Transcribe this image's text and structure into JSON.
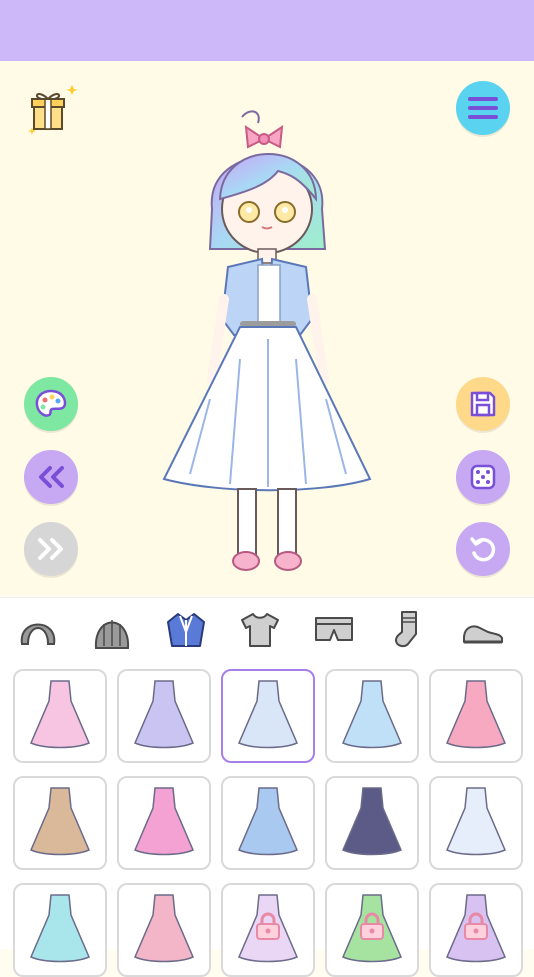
{
  "colors": {
    "topbar": "#cdb9fa",
    "stage_bg": "#fffbe6",
    "accent_purple": "#c7a8f2",
    "menu_blue": "#5ad3f0",
    "palette_green": "#7ee7a1",
    "save_yellow": "#ffd98a",
    "disabled_gray": "#d6d6d6",
    "selected_border": "#a77fe6"
  },
  "top_left": {
    "icon": "gift-box-icon"
  },
  "top_right": {
    "icon": "hamburger-menu-icon"
  },
  "left_controls": [
    {
      "name": "color-palette-button",
      "icon": "palette-icon"
    },
    {
      "name": "previous-button",
      "icon": "double-chevron-left-icon"
    },
    {
      "name": "next-button",
      "icon": "double-chevron-right-icon",
      "disabled": true
    }
  ],
  "right_controls": [
    {
      "name": "save-button",
      "icon": "floppy-disk-icon"
    },
    {
      "name": "randomize-button",
      "icon": "dice-icon"
    },
    {
      "name": "reset-button",
      "icon": "undo-icon"
    }
  ],
  "categories": [
    {
      "name": "hair",
      "icon": "hair-icon"
    },
    {
      "name": "back-hair",
      "icon": "long-hair-icon"
    },
    {
      "name": "jacket",
      "icon": "jacket-icon",
      "selected": true
    },
    {
      "name": "top",
      "icon": "tshirt-icon"
    },
    {
      "name": "bottom",
      "icon": "shorts-icon"
    },
    {
      "name": "socks",
      "icon": "sock-icon"
    },
    {
      "name": "shoes",
      "icon": "shoe-icon"
    }
  ],
  "items": [
    {
      "name": "pink-tiered-dress",
      "color": "#f7c4e2",
      "locked": false
    },
    {
      "name": "lavender-dress",
      "color": "#c9c4f2",
      "locked": false
    },
    {
      "name": "white-dress-bouquet",
      "color": "#d8e6f7",
      "locked": false,
      "selected": true
    },
    {
      "name": "blue-mermaid-dress",
      "color": "#bfe0f7",
      "locked": false
    },
    {
      "name": "pink-hoodie",
      "color": "#f7a9c1",
      "locked": false
    },
    {
      "name": "beige-outfit",
      "color": "#d9b99a",
      "locked": false
    },
    {
      "name": "pink-ruffle-dress",
      "color": "#f4a2d4",
      "locked": false
    },
    {
      "name": "blue-flowy-dress",
      "color": "#a9c9f0",
      "locked": false
    },
    {
      "name": "navy-heart-dress",
      "color": "#5c5a86",
      "locked": false
    },
    {
      "name": "sailor-top",
      "color": "#e7eefb",
      "locked": false
    },
    {
      "name": "mint-dress",
      "color": "#a8e6ec",
      "locked": false
    },
    {
      "name": "pink-gown",
      "color": "#f3b6c8",
      "locked": false
    },
    {
      "name": "pastel-dress",
      "color": "#ead6f5",
      "locked": true
    },
    {
      "name": "green-dress",
      "color": "#a6e3a1",
      "locked": true
    },
    {
      "name": "purple-dress",
      "color": "#d8c2f1",
      "locked": true
    }
  ]
}
